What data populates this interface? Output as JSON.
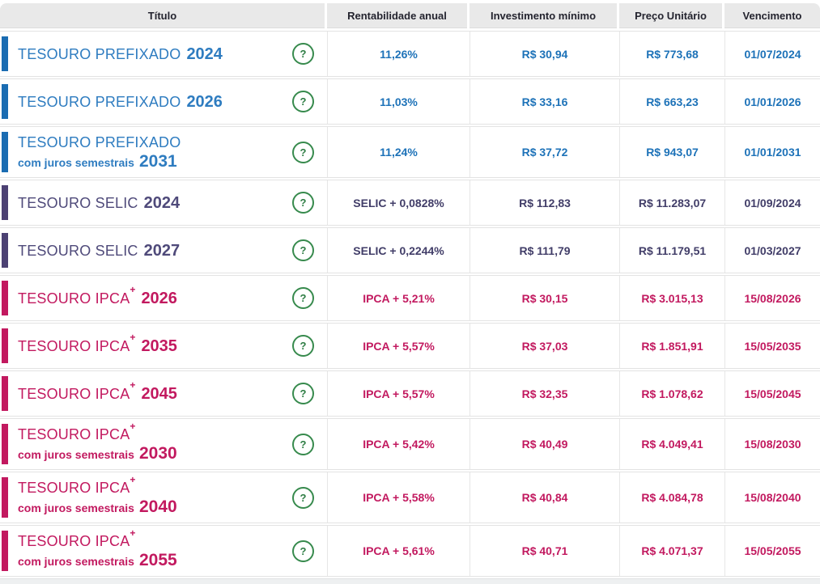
{
  "table": {
    "columns": [
      "Título",
      "Rentabilidade anual",
      "Investimento mínimo",
      "Preço Unitário",
      "Vencimento"
    ],
    "help_icon": "?",
    "colors": {
      "prefixado": {
        "bar": "#1a6cb2",
        "title": "#2e7cc0",
        "value": "#1d72b8"
      },
      "selic": {
        "bar": "#4c4173",
        "title": "#4f4a7a",
        "value": "#413d68"
      },
      "ipca": {
        "bar": "#c2195f",
        "title": "#c2195f",
        "value": "#c2195f"
      },
      "help_green": "#378a4d",
      "header_bg": "#e9e9e9"
    },
    "rows": [
      {
        "group": "prefixado",
        "name": "TESOURO PREFIXADO",
        "sup": "",
        "subtitle": "",
        "year": "2024",
        "rate": "11,26%",
        "min": "R$ 30,94",
        "price": "R$ 773,68",
        "maturity": "01/07/2024"
      },
      {
        "group": "prefixado",
        "name": "TESOURO PREFIXADO",
        "sup": "",
        "subtitle": "",
        "year": "2026",
        "rate": "11,03%",
        "min": "R$ 33,16",
        "price": "R$ 663,23",
        "maturity": "01/01/2026"
      },
      {
        "group": "prefixado",
        "name": "TESOURO PREFIXADO",
        "sup": "",
        "subtitle": "com juros semestrais",
        "year": "2031",
        "rate": "11,24%",
        "min": "R$ 37,72",
        "price": "R$ 943,07",
        "maturity": "01/01/2031"
      },
      {
        "group": "selic",
        "name": "TESOURO SELIC",
        "sup": "",
        "subtitle": "",
        "year": "2024",
        "rate": "SELIC + 0,0828%",
        "min": "R$ 112,83",
        "price": "R$ 11.283,07",
        "maturity": "01/09/2024"
      },
      {
        "group": "selic",
        "name": "TESOURO SELIC",
        "sup": "",
        "subtitle": "",
        "year": "2027",
        "rate": "SELIC + 0,2244%",
        "min": "R$ 111,79",
        "price": "R$ 11.179,51",
        "maturity": "01/03/2027"
      },
      {
        "group": "ipca",
        "name": "TESOURO IPCA",
        "sup": "+",
        "subtitle": "",
        "year": "2026",
        "rate": "IPCA + 5,21%",
        "min": "R$ 30,15",
        "price": "R$ 3.015,13",
        "maturity": "15/08/2026"
      },
      {
        "group": "ipca",
        "name": "TESOURO IPCA",
        "sup": "+",
        "subtitle": "",
        "year": "2035",
        "rate": "IPCA + 5,57%",
        "min": "R$ 37,03",
        "price": "R$ 1.851,91",
        "maturity": "15/05/2035"
      },
      {
        "group": "ipca",
        "name": "TESOURO IPCA",
        "sup": "+",
        "subtitle": "",
        "year": "2045",
        "rate": "IPCA + 5,57%",
        "min": "R$ 32,35",
        "price": "R$ 1.078,62",
        "maturity": "15/05/2045"
      },
      {
        "group": "ipca",
        "name": "TESOURO IPCA",
        "sup": "+",
        "subtitle": "com juros semestrais",
        "year": "2030",
        "rate": "IPCA + 5,42%",
        "min": "R$ 40,49",
        "price": "R$ 4.049,41",
        "maturity": "15/08/2030"
      },
      {
        "group": "ipca",
        "name": "TESOURO IPCA",
        "sup": "+",
        "subtitle": "com juros semestrais",
        "year": "2040",
        "rate": "IPCA + 5,58%",
        "min": "R$ 40,84",
        "price": "R$ 4.084,78",
        "maturity": "15/08/2040"
      },
      {
        "group": "ipca",
        "name": "TESOURO IPCA",
        "sup": "+",
        "subtitle": "com juros semestrais",
        "year": "2055",
        "rate": "IPCA + 5,61%",
        "min": "R$ 40,71",
        "price": "R$ 4.071,37",
        "maturity": "15/05/2055"
      }
    ]
  }
}
